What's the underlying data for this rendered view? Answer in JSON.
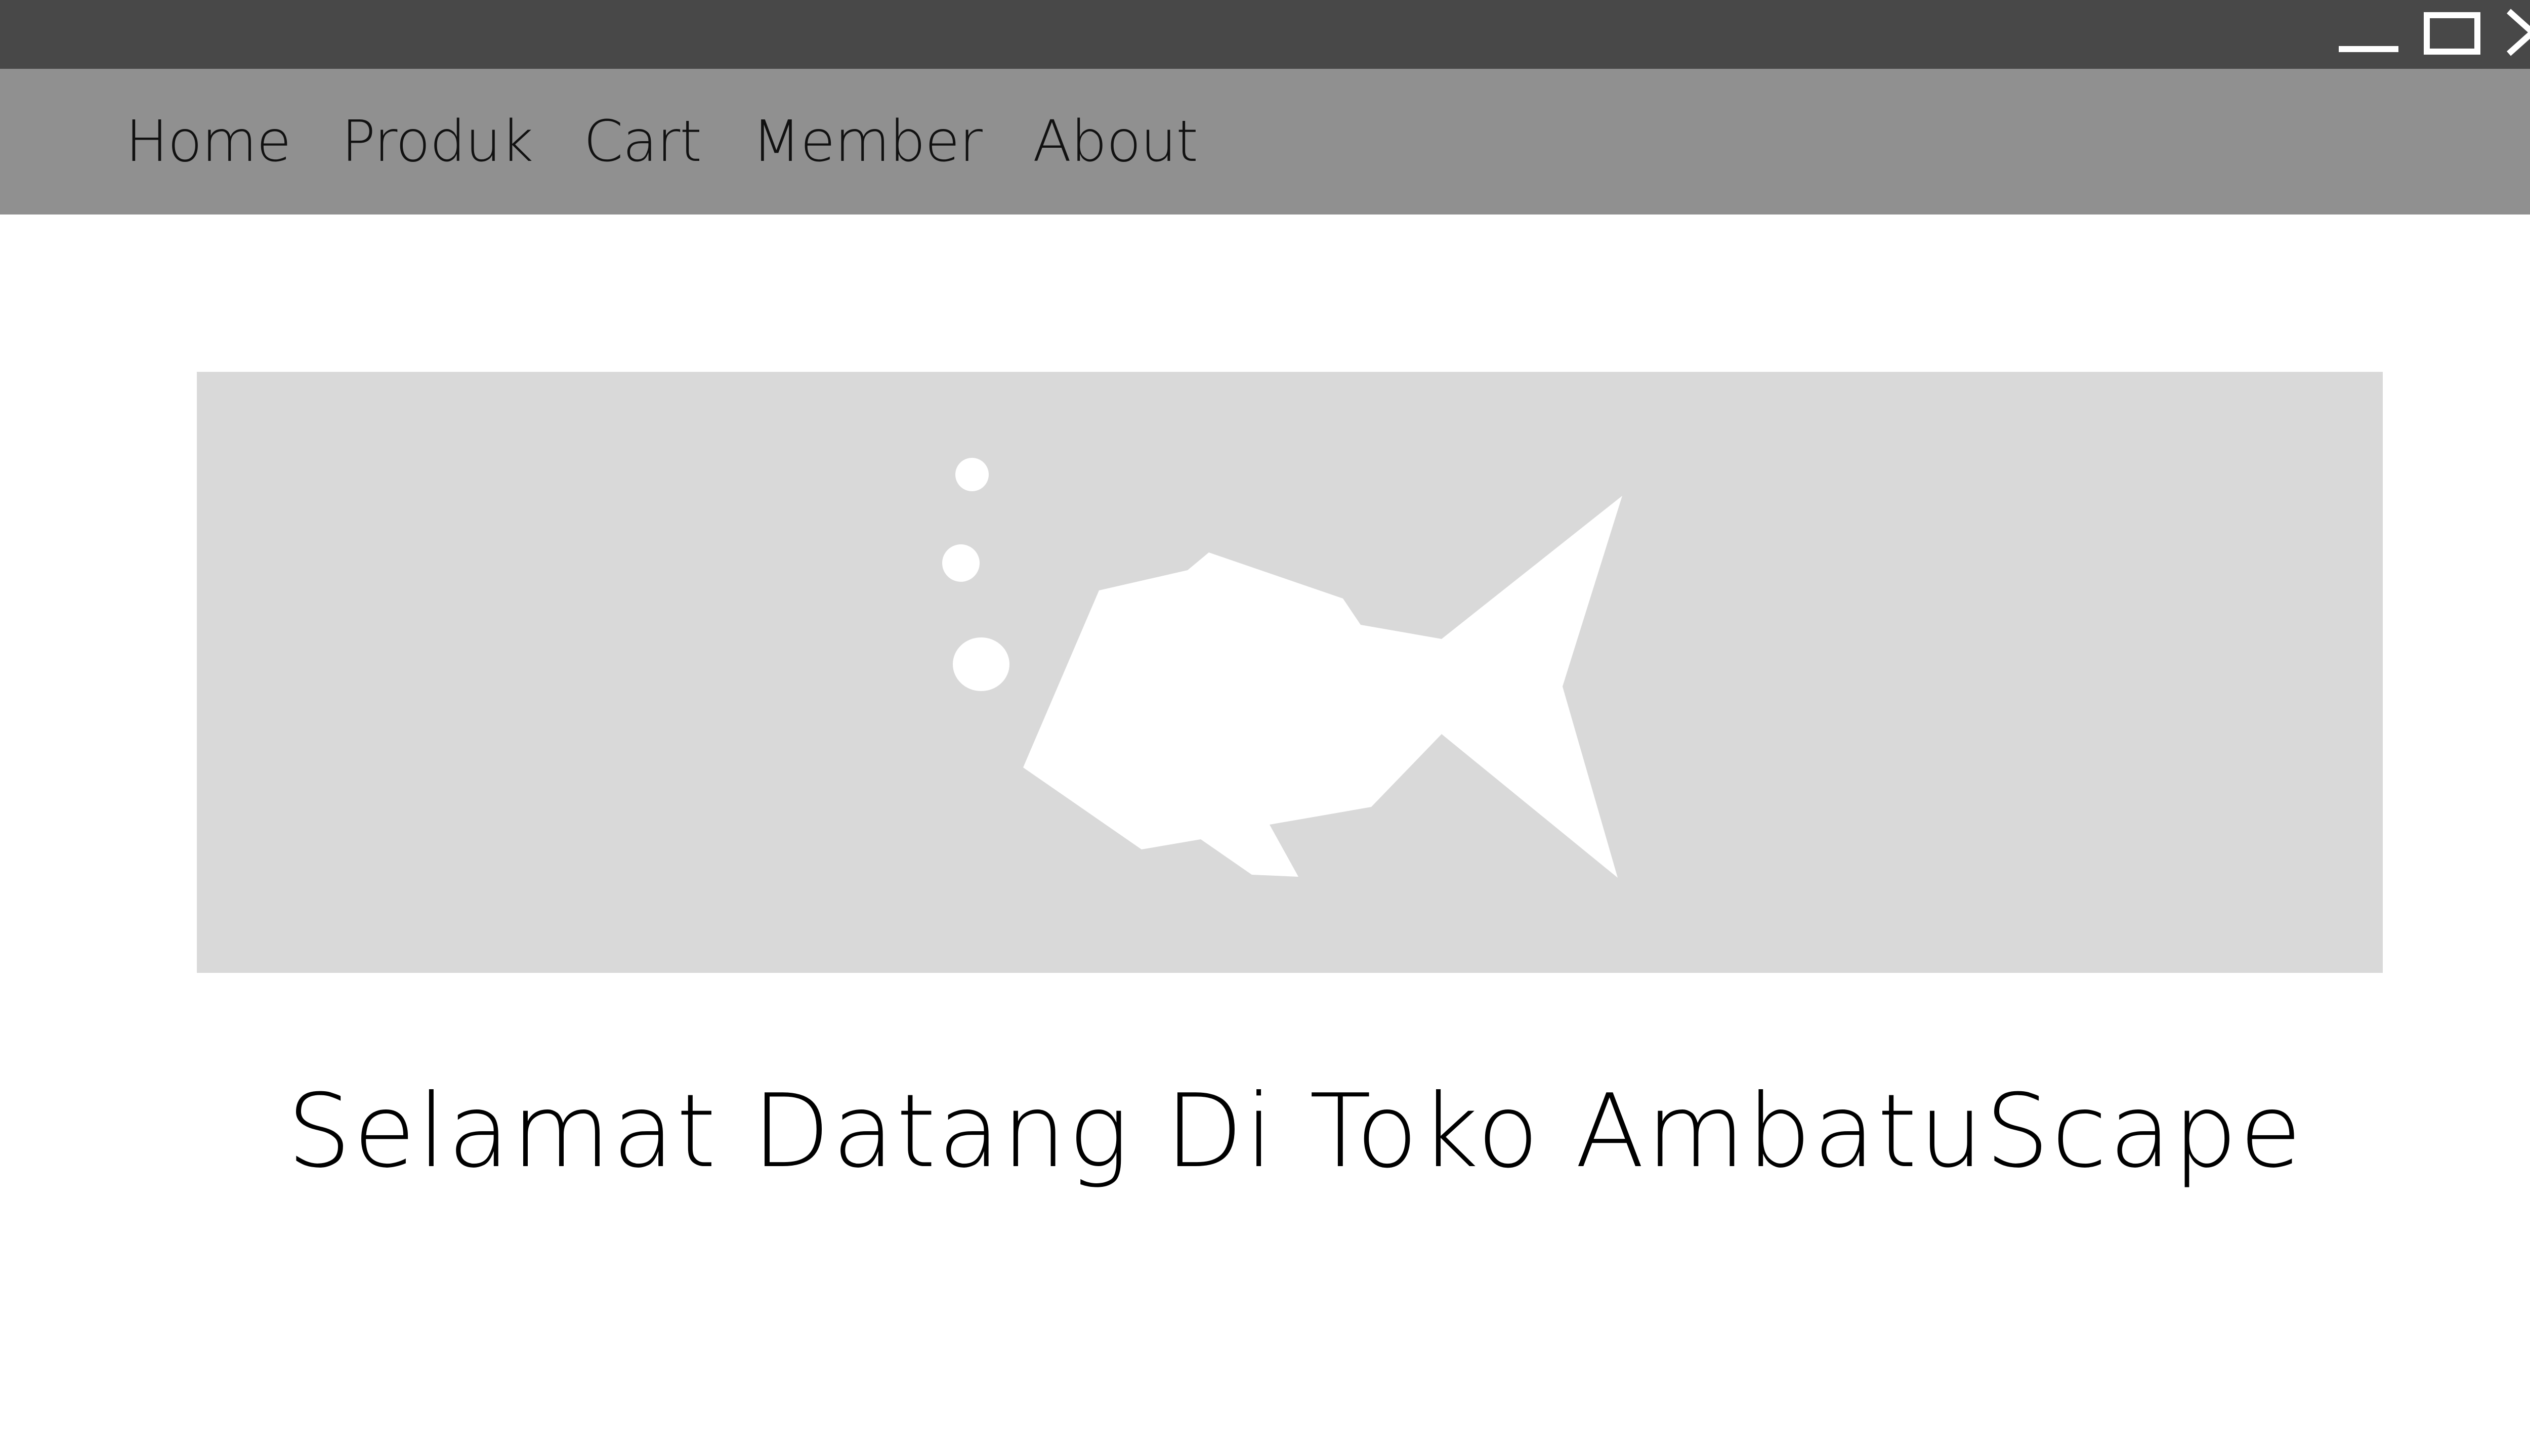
{
  "window": {
    "controls": [
      {
        "name": "minimize",
        "icon": "minimize-icon"
      },
      {
        "name": "maximize",
        "icon": "maximize-icon"
      },
      {
        "name": "close",
        "icon": "close-icon"
      }
    ],
    "titlebar_color": "#484848"
  },
  "nav": {
    "background": "#909090",
    "items": [
      {
        "label": "Home"
      },
      {
        "label": "Produk"
      },
      {
        "label": "Cart"
      },
      {
        "label": "Member"
      },
      {
        "label": "About"
      }
    ]
  },
  "hero": {
    "image": "fish-placeholder-image",
    "background": "#d9d9d9"
  },
  "main": {
    "welcome_text": "Selamat Datang Di Toko AmbatuScape"
  }
}
